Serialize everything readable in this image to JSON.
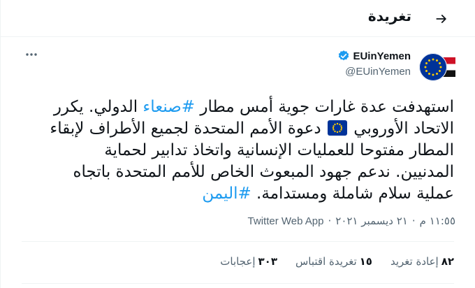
{
  "header": {
    "title": "تغريدة",
    "back_icon": "arrow-right-icon"
  },
  "author": {
    "name": "EUinYemen",
    "handle": "@EUinYemen",
    "verified_icon": "verified-badge-icon",
    "avatar": "eu-yemen-flag-avatar"
  },
  "tweet": {
    "line1_pre": "استهدفت عدة غارات جوية أمس مطار ",
    "hashtag_sanaa": "#صنعاء",
    "line1_post": " الدولي. يكرر",
    "line2_pre": "الاتحاد الأوروبي ",
    "line2_post": " دعوة الأمم المتحدة لجميع الأطراف لإبقاء",
    "line3": "المطار مفتوحا للعمليات الإنسانية واتخاذ تدابير لحماية",
    "line4": "المدنيين. ندعم جهود المبعوث الخاص للأمم المتحدة باتجاه",
    "line5_pre": "عملية سلام شاملة ومستدامة. ",
    "hashtag_yemen": "#اليمن"
  },
  "meta": {
    "time": "١١:٥٥ م",
    "separator": "·",
    "date": "٢١ ديسمبر ٢٠٢١",
    "source": "Twitter Web App"
  },
  "stats": {
    "retweets_count": "٨٢",
    "retweets_label": "إعادة تغريد",
    "quotes_count": "١٥",
    "quotes_label": "تغريدة اقتباس",
    "likes_count": "٣٠٣",
    "likes_label": "إعجابات"
  },
  "colors": {
    "link": "#1d9bf0",
    "muted": "#536471",
    "text": "#0f1419",
    "eu_blue": "#003399",
    "eu_gold": "#ffcc00"
  }
}
